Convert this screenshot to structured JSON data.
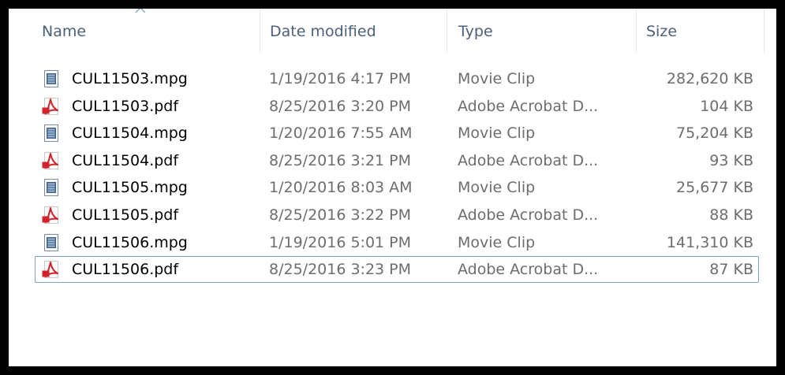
{
  "columns": {
    "name": "Name",
    "date": "Date modified",
    "type": "Type",
    "size": "Size"
  },
  "sort": {
    "column": "Name",
    "indicator": "sort-ascending-icon"
  },
  "files": [
    {
      "name": "CUL11503.mpg",
      "date": "1/19/2016 4:17 PM",
      "type": "Movie Clip",
      "size": "282,620 KB",
      "icon": "movie-clip-icon"
    },
    {
      "name": "CUL11503.pdf",
      "date": "8/25/2016 3:20 PM",
      "type": "Adobe Acrobat D...",
      "size": "104 KB",
      "icon": "pdf-icon"
    },
    {
      "name": "CUL11504.mpg",
      "date": "1/20/2016 7:55 AM",
      "type": "Movie Clip",
      "size": "75,204 KB",
      "icon": "movie-clip-icon"
    },
    {
      "name": "CUL11504.pdf",
      "date": "8/25/2016 3:21 PM",
      "type": "Adobe Acrobat D...",
      "size": "93 KB",
      "icon": "pdf-icon"
    },
    {
      "name": "CUL11505.mpg",
      "date": "1/20/2016 8:03 AM",
      "type": "Movie Clip",
      "size": "25,677 KB",
      "icon": "movie-clip-icon"
    },
    {
      "name": "CUL11505.pdf",
      "date": "8/25/2016 3:22 PM",
      "type": "Adobe Acrobat D...",
      "size": "88 KB",
      "icon": "pdf-icon"
    },
    {
      "name": "CUL11506.mpg",
      "date": "1/19/2016 5:01 PM",
      "type": "Movie Clip",
      "size": "141,310 KB",
      "icon": "movie-clip-icon"
    },
    {
      "name": "CUL11506.pdf",
      "date": "8/25/2016 3:23 PM",
      "type": "Adobe Acrobat D...",
      "size": "87 KB",
      "icon": "pdf-icon",
      "focused": true
    }
  ],
  "colors": {
    "frame": "#000000",
    "header_text": "#4c607a",
    "detail_text": "#6d6d6d",
    "focus_border": "#7da2ce",
    "pdf_red": "#d2232a"
  }
}
